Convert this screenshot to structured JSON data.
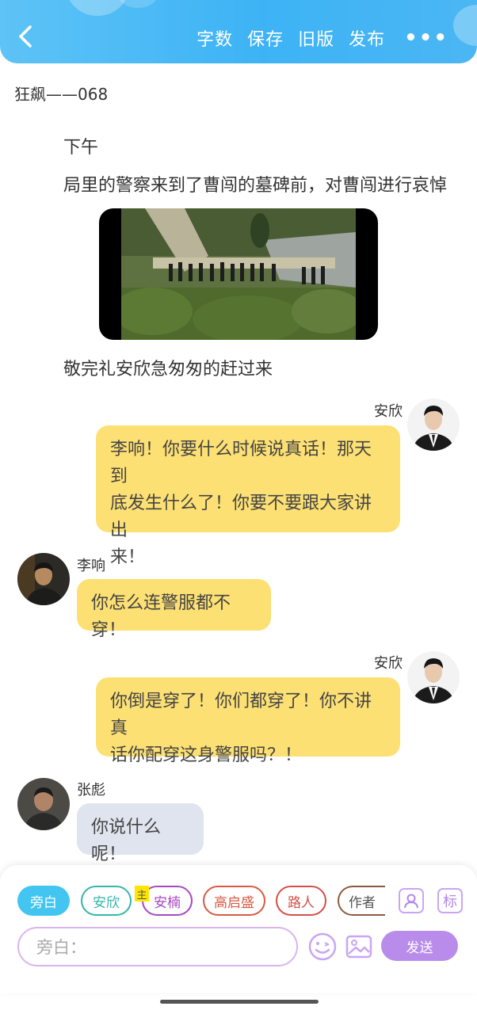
{
  "header": {
    "actions": [
      "字数",
      "保存",
      "旧版",
      "发布"
    ],
    "more": "•••",
    "back_icon": "chevron-left-icon",
    "color": "#3db3f5"
  },
  "chapter_title": "狂飙——068",
  "narrations": [
    "下午",
    "局里的警察来到了曹闯的墓碑前，对曹闯进行哀悼",
    "敬完礼安欣急匆匆的赶过来"
  ],
  "scene_image": {
    "description_icon": "cemetery-image"
  },
  "messages": [
    {
      "speaker": "安欣",
      "text_lines": [
        "李响！你要什么时候说真话！那天到",
        "底发生什么了！你要不要跟大家讲出",
        "来！"
      ]
    },
    {
      "speaker": "李响",
      "text_lines": [
        "你怎么连警服都不穿！"
      ]
    },
    {
      "speaker": "安欣",
      "text_lines": [
        "你倒是穿了！你们都穿了！你不讲真",
        "话你配穿这身警服吗？！"
      ]
    },
    {
      "speaker": "张彪",
      "text_lines": [
        "你说什么呢！"
      ]
    }
  ],
  "roles": [
    {
      "label": "旁白",
      "color": "#3ec3f0",
      "selected": true
    },
    {
      "label": "安欣",
      "color": "#35b6a8"
    },
    {
      "label": "安楠",
      "color": "#a64ac0"
    },
    {
      "label": "高启盛",
      "color": "#d85a43"
    },
    {
      "label": "路人",
      "color": "#d35048"
    },
    {
      "label": "作者",
      "color": "#8c5a3c"
    }
  ],
  "main_badge": "主",
  "tools": {
    "character_icon": "character-card-icon",
    "tag_label": "标"
  },
  "input": {
    "placeholder": "旁白："
  },
  "send_label": "发送",
  "accent": "#b98cec",
  "bubble_yellow": "#fde073",
  "bubble_grey": "#dfe4ee"
}
